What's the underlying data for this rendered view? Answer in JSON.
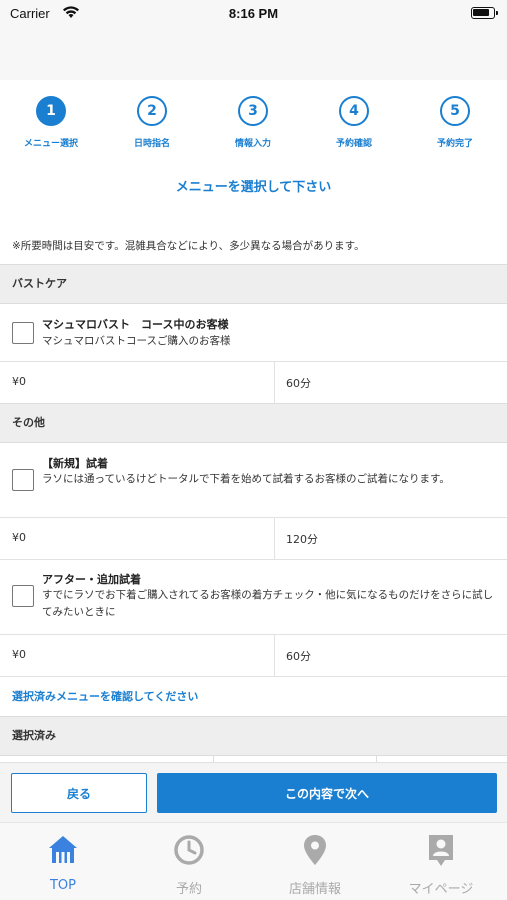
{
  "status_bar": {
    "carrier": "Carrier",
    "time": "8:16 PM"
  },
  "steps": [
    {
      "number": "1",
      "label": "メニュー選択"
    },
    {
      "number": "2",
      "label": "日時指名"
    },
    {
      "number": "3",
      "label": "情報入力"
    },
    {
      "number": "4",
      "label": "予約確認"
    },
    {
      "number": "5",
      "label": "予約完了"
    }
  ],
  "active_step": 1,
  "page_heading": "メニューを選択して下さい",
  "note": "※所要時間は目安です。混雑具合などにより、多少異なる場合があります。",
  "sections": {
    "bust_care": {
      "title": "バストケア",
      "items": [
        {
          "title": "マシュマロバスト　コース中のお客様",
          "description": "マシュマロバストコースご購入のお客様",
          "price": "¥0",
          "duration": "60分"
        }
      ]
    },
    "other": {
      "title": "その他",
      "items": [
        {
          "title": "【新規】試着",
          "description": "ラソには通っているけどトータルで下着を始めて試着するお客様のご試着になります。",
          "price": "¥0",
          "duration": "120分"
        },
        {
          "title": "アフター・追加試着",
          "description": "すでにラソでお下着ご購入されてるお客様の着方チェック・他に気になるものだけをさらに試してみたいときに",
          "price": "¥0",
          "duration": "60分"
        }
      ]
    },
    "selected": {
      "title": "選択済み"
    }
  },
  "confirm_link": "選択済みメニューを確認してください",
  "actions": {
    "back": "戻る",
    "next": "この内容で次へ"
  },
  "tabs": [
    {
      "label": "TOP",
      "icon": "home-icon"
    },
    {
      "label": "予約",
      "icon": "clock-icon"
    },
    {
      "label": "店舗情報",
      "icon": "location-pin-icon"
    },
    {
      "label": "マイページ",
      "icon": "contact-card-icon"
    }
  ],
  "active_tab": "TOP",
  "colors": {
    "accent": "#1a7fd0",
    "tab_active": "#3b82e0",
    "tab_inactive": "#aaaaaa"
  }
}
